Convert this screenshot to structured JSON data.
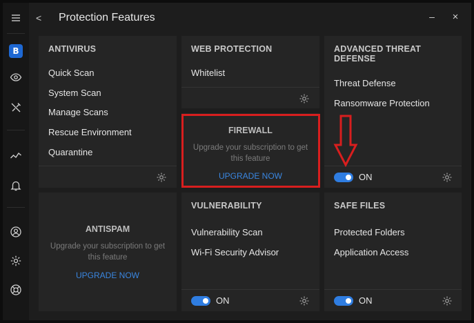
{
  "window": {
    "title": "Protection Features",
    "back_label": "<",
    "minimize_label": "–",
    "close_label": "×"
  },
  "rail": {
    "brand_letter": "B"
  },
  "cards": {
    "antivirus": {
      "title": "ANTIVIRUS",
      "items": [
        "Quick Scan",
        "System Scan",
        "Manage Scans",
        "Rescue Environment",
        "Quarantine"
      ]
    },
    "web_protection": {
      "title": "WEB PROTECTION",
      "items": [
        "Whitelist"
      ]
    },
    "advanced_threat_defense": {
      "title": "ADVANCED THREAT DEFENSE",
      "items": [
        "Threat Defense",
        "Ransomware Protection"
      ],
      "toggle_label": "ON"
    },
    "firewall": {
      "title": "FIREWALL",
      "message": "Upgrade your subscription to get this feature",
      "link": "UPGRADE NOW"
    },
    "antispam": {
      "title": "ANTISPAM",
      "message": "Upgrade your subscription to get this feature",
      "link": "UPGRADE NOW"
    },
    "vulnerability": {
      "title": "VULNERABILITY",
      "items": [
        "Vulnerability Scan",
        "Wi-Fi Security Advisor"
      ],
      "toggle_label": "ON"
    },
    "safe_files": {
      "title": "SAFE FILES",
      "items": [
        "Protected Folders",
        "Application Access"
      ],
      "toggle_label": "ON"
    }
  },
  "colors": {
    "accent": "#2f7de1",
    "link": "#3a86e0",
    "highlight": "#d81e1e",
    "card": "#252525",
    "background": "#1d1d1d"
  }
}
